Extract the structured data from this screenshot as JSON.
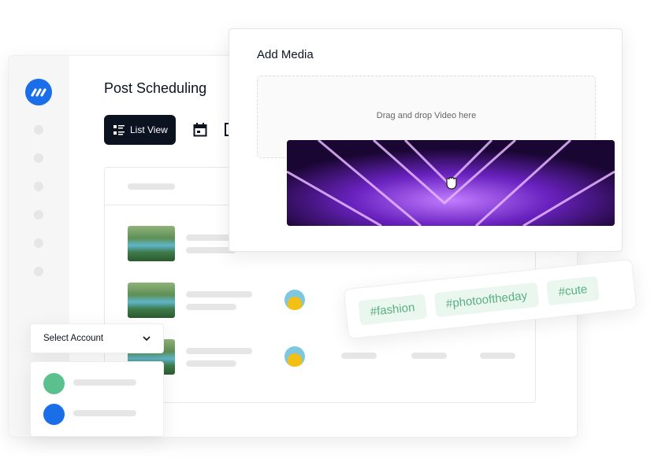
{
  "colors": {
    "brand": "#1a6fe8",
    "dark": "#0b1320",
    "hashtag_text": "#5aaf7f",
    "hashtag_bg": "#eaf7ef",
    "green_account": "#5ac18e"
  },
  "app": {
    "logo_icon": "brand-logo",
    "title": "Post Scheduling"
  },
  "toolbar": {
    "list_view_label": "List View",
    "list_icon": "list-icon",
    "calendar_icon": "calendar-icon"
  },
  "modal": {
    "title": "Add Media",
    "dropzone_text": "Drag and drop Video here",
    "cursor_icon": "hand-grab-icon"
  },
  "hashtags": [
    "#fashion",
    "#photooftheday",
    "#cute"
  ],
  "account_select": {
    "label": "Select Account",
    "icon": "chevron-down-icon"
  }
}
